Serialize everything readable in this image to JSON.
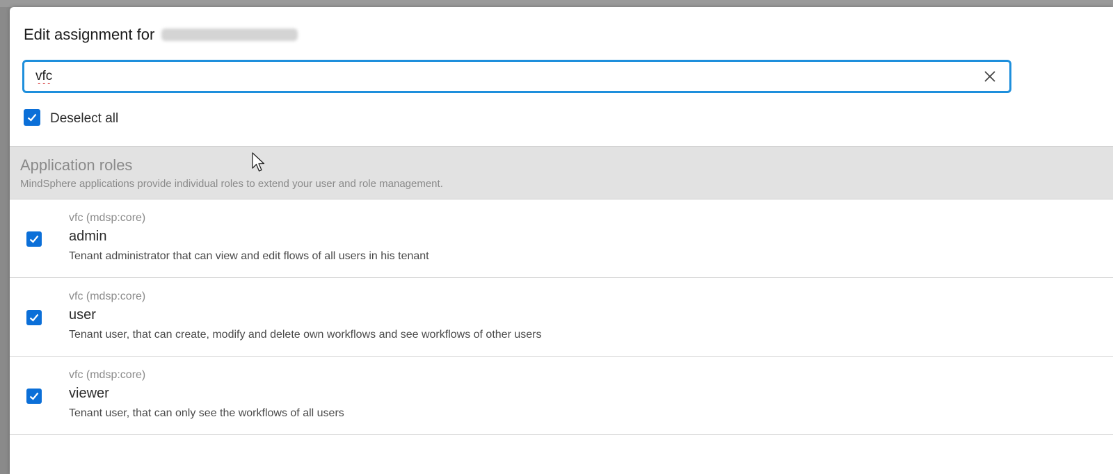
{
  "dialog": {
    "title": "Edit assignment for"
  },
  "search": {
    "value": "vfc",
    "clear_icon": "close-icon"
  },
  "select_all": {
    "label": "Deselect all",
    "checked": true
  },
  "section": {
    "title": "Application roles",
    "description": "MindSphere applications provide individual roles to extend your user and role management."
  },
  "roles": [
    {
      "app": "vfc (mdsp:core)",
      "name": "admin",
      "description": "Tenant administrator that can view and edit flows of all users in his tenant",
      "checked": true
    },
    {
      "app": "vfc (mdsp:core)",
      "name": "user",
      "description": "Tenant user, that can create, modify and delete own workflows and see workflows of other users",
      "checked": true
    },
    {
      "app": "vfc (mdsp:core)",
      "name": "viewer",
      "description": "Tenant user, that can only see the workflows of all users",
      "checked": true
    }
  ],
  "colors": {
    "accent": "#1e8fdc",
    "checkbox": "#0b6fd8",
    "section_bg": "#e2e2e2"
  }
}
